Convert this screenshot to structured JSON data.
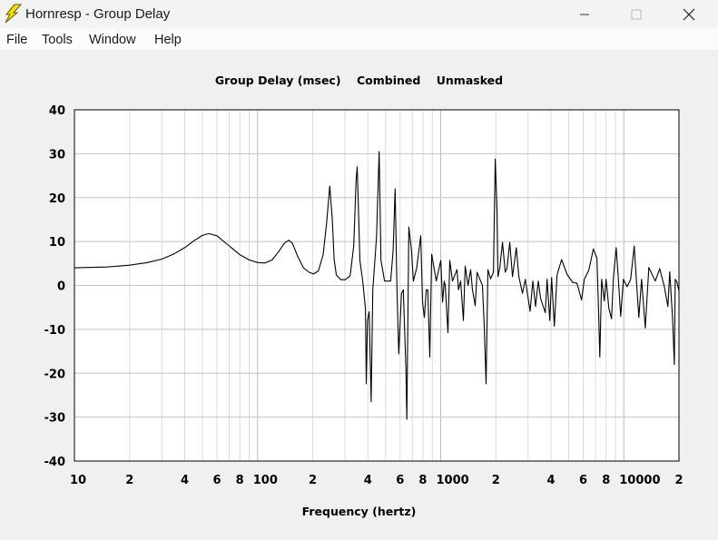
{
  "window": {
    "title": "Hornresp - Group Delay",
    "app_icon": "lightning-bolt-icon",
    "controls": [
      "minimize-icon",
      "maximize-icon",
      "close-icon"
    ]
  },
  "menu": {
    "items": [
      {
        "label": "File"
      },
      {
        "label": "Tools"
      },
      {
        "label": "Window"
      },
      {
        "label": "Help"
      }
    ]
  },
  "chart_title": {
    "quantity": "Group Delay (msec)",
    "mode": "Combined",
    "mask": "Unmasked"
  },
  "chart_data": {
    "type": "line",
    "title": "Group Delay (msec)    Combined    Unmasked",
    "xlabel": "Frequency (hertz)",
    "ylabel": "",
    "xscale": "log",
    "xlim": [
      10,
      20000
    ],
    "ylim": [
      -40,
      40
    ],
    "grid": true,
    "line_color": "#000000",
    "yticks": [
      40,
      30,
      20,
      10,
      0,
      -10,
      -20,
      -30,
      -40
    ],
    "ytick_labels": [
      "40",
      "30",
      "20",
      "10",
      "0",
      "-10",
      "-20",
      "-30",
      "-40"
    ],
    "xticks": [
      10,
      20,
      40,
      60,
      80,
      100,
      200,
      400,
      600,
      800,
      1000,
      2000,
      4000,
      6000,
      8000,
      10000,
      20000
    ],
    "xtick_labels": [
      "10",
      "2",
      "4",
      "6",
      "8",
      "100",
      "2",
      "4",
      "6",
      "8",
      "1000",
      "2",
      "4",
      "6",
      "8",
      "10000",
      "2"
    ],
    "series": [
      {
        "points": [
          [
            10,
            4.0
          ],
          [
            15,
            4.2
          ],
          [
            20,
            4.6
          ],
          [
            25,
            5.2
          ],
          [
            30,
            6.0
          ],
          [
            35,
            7.2
          ],
          [
            40,
            8.6
          ],
          [
            45,
            10.2
          ],
          [
            50,
            11.4
          ],
          [
            54,
            11.8
          ],
          [
            60,
            11.3
          ],
          [
            70,
            9.0
          ],
          [
            80,
            7.0
          ],
          [
            90,
            5.8
          ],
          [
            100,
            5.2
          ],
          [
            110,
            5.1
          ],
          [
            120,
            5.8
          ],
          [
            130,
            7.6
          ],
          [
            140,
            9.6
          ],
          [
            148,
            10.3
          ],
          [
            155,
            9.6
          ],
          [
            165,
            6.8
          ],
          [
            178,
            4.0
          ],
          [
            191,
            3.0
          ],
          [
            202,
            2.6
          ],
          [
            215,
            3.3
          ],
          [
            228,
            7
          ],
          [
            238,
            14
          ],
          [
            248,
            22.6
          ],
          [
            256,
            15
          ],
          [
            262,
            6
          ],
          [
            269,
            2.4
          ],
          [
            285,
            1.3
          ],
          [
            301,
            1.3
          ],
          [
            320,
            2.2
          ],
          [
            335,
            9
          ],
          [
            345,
            24
          ],
          [
            350,
            27
          ],
          [
            355,
            18
          ],
          [
            362,
            5.7
          ],
          [
            375,
            1
          ],
          [
            388,
            -5.3
          ],
          [
            392,
            -22.4
          ],
          [
            398,
            -8
          ],
          [
            407,
            -6
          ],
          [
            417,
            -26.5
          ],
          [
            426,
            -1
          ],
          [
            446,
            11
          ],
          [
            461,
            30.5
          ],
          [
            472,
            5.7
          ],
          [
            494,
            1
          ],
          [
            533,
            1
          ],
          [
            550,
            8
          ],
          [
            564,
            22
          ],
          [
            577,
            -0.5
          ],
          [
            590,
            -15.6
          ],
          [
            611,
            -1.8
          ],
          [
            625,
            -1
          ],
          [
            646,
            -19
          ],
          [
            653,
            -30.5
          ],
          [
            670,
            13.3
          ],
          [
            693,
            7.8
          ],
          [
            709,
            1
          ],
          [
            740,
            4
          ],
          [
            778,
            11.3
          ],
          [
            796,
            -3.8
          ],
          [
            814,
            -7.3
          ],
          [
            834,
            -1
          ],
          [
            850,
            -1
          ],
          [
            872,
            -16.3
          ],
          [
            893,
            7.1
          ],
          [
            945,
            1
          ],
          [
            1001,
            5.7
          ],
          [
            1024,
            -3.8
          ],
          [
            1045,
            1
          ],
          [
            1059,
            0
          ],
          [
            1096,
            -10.8
          ],
          [
            1121,
            5.7
          ],
          [
            1160,
            1
          ],
          [
            1228,
            3.6
          ],
          [
            1250,
            -1
          ],
          [
            1285,
            1
          ],
          [
            1330,
            -8
          ],
          [
            1361,
            4.4
          ],
          [
            1409,
            0
          ],
          [
            1458,
            3.6
          ],
          [
            1491,
            -1
          ],
          [
            1543,
            -4.6
          ],
          [
            1580,
            3
          ],
          [
            1615,
            2
          ],
          [
            1690,
            0
          ],
          [
            1730,
            -9.4
          ],
          [
            1770,
            -22.4
          ],
          [
            1811,
            3.6
          ],
          [
            1874,
            1.5
          ],
          [
            1940,
            3
          ],
          [
            1986,
            28.8
          ],
          [
            2032,
            16.8
          ],
          [
            2055,
            2
          ],
          [
            2101,
            4
          ],
          [
            2175,
            9.8
          ],
          [
            2251,
            3
          ],
          [
            2303,
            4
          ],
          [
            2383,
            9.8
          ],
          [
            2467,
            2
          ],
          [
            2586,
            8.6
          ],
          [
            2672,
            2
          ],
          [
            2797,
            -1.8
          ],
          [
            2895,
            1.4
          ],
          [
            3078,
            -5.9
          ],
          [
            3185,
            1
          ],
          [
            3296,
            -4.8
          ],
          [
            3412,
            1
          ],
          [
            3514,
            -3
          ],
          [
            3722,
            -6.2
          ],
          [
            3808,
            1.4
          ],
          [
            3943,
            -8
          ],
          [
            4034,
            1.8
          ],
          [
            4172,
            -9.3
          ],
          [
            4318,
            2.4
          ],
          [
            4570,
            5.9
          ],
          [
            4900,
            2.5
          ],
          [
            5245,
            0.7
          ],
          [
            5546,
            0.5
          ],
          [
            5880,
            -3.3
          ],
          [
            6085,
            1.4
          ],
          [
            6440,
            3.5
          ],
          [
            6814,
            8.3
          ],
          [
            7130,
            6.2
          ],
          [
            7296,
            -7
          ],
          [
            7390,
            -16.3
          ],
          [
            7560,
            1.4
          ],
          [
            7820,
            -3.5
          ],
          [
            8000,
            1.4
          ],
          [
            8285,
            -5.2
          ],
          [
            8570,
            -7.6
          ],
          [
            8770,
            1.8
          ],
          [
            9075,
            8.6
          ],
          [
            9288,
            2.8
          ],
          [
            9610,
            -7
          ],
          [
            9945,
            1.4
          ],
          [
            10413,
            -0.3
          ],
          [
            10900,
            1.4
          ],
          [
            11400,
            9
          ],
          [
            11675,
            2.1
          ],
          [
            12080,
            -7.3
          ],
          [
            12500,
            1.4
          ],
          [
            13089,
            -9.7
          ],
          [
            13700,
            4.1
          ],
          [
            14840,
            1
          ],
          [
            15700,
            3.8
          ],
          [
            16640,
            -0.3
          ],
          [
            17400,
            -4.8
          ],
          [
            17800,
            3.1
          ],
          [
            18443,
            -7.3
          ],
          [
            18870,
            -18
          ],
          [
            19080,
            1.4
          ],
          [
            19520,
            0.7
          ],
          [
            19970,
            -1.2
          ]
        ]
      }
    ]
  }
}
